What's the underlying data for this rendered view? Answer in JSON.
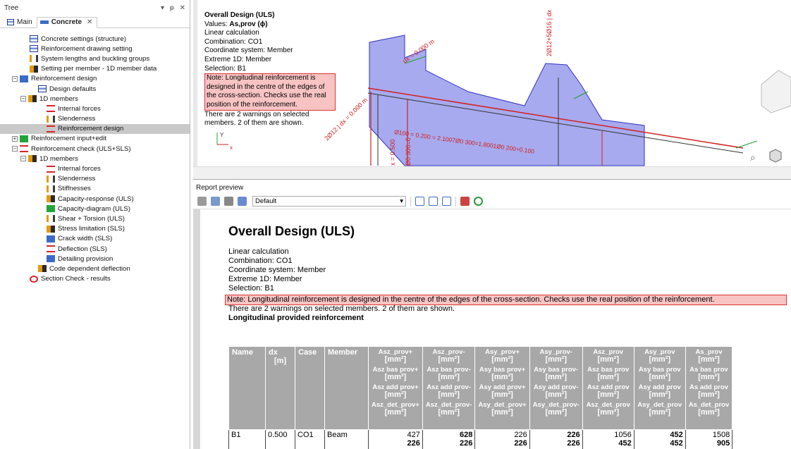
{
  "tree": {
    "title": "Tree",
    "controls": [
      "▾",
      "ᵽ",
      "✕"
    ],
    "tabs": [
      {
        "label": "Main",
        "active": false
      },
      {
        "label": "Concrete",
        "active": true
      }
    ],
    "items": [
      {
        "label": "Concrete settings (structure)",
        "indent": 1,
        "icon": "doc",
        "exp": ""
      },
      {
        "label": "Reinforcement drawing setting",
        "indent": 1,
        "icon": "doc",
        "exp": ""
      },
      {
        "label": "System lengths and buckling groups",
        "indent": 1,
        "icon": "bars",
        "exp": ""
      },
      {
        "label": "Setting per member - 1D member data",
        "indent": 1,
        "icon": "ora",
        "exp": ""
      },
      {
        "label": "Reinforcement design",
        "indent": 0,
        "icon": "blu",
        "exp": "−"
      },
      {
        "label": "Design defaults",
        "indent": 2,
        "icon": "doc",
        "exp": ""
      },
      {
        "label": "1D members",
        "indent": 1,
        "icon": "ora",
        "exp": "−"
      },
      {
        "label": "Internal forces",
        "indent": 3,
        "icon": "red",
        "exp": ""
      },
      {
        "label": "Slenderness",
        "indent": 3,
        "icon": "bars",
        "exp": ""
      },
      {
        "label": "Reinforcement design",
        "indent": 3,
        "icon": "red",
        "exp": "",
        "selected": true
      },
      {
        "label": "Reinforcement input+edit",
        "indent": 0,
        "icon": "grn",
        "exp": "+"
      },
      {
        "label": "Reinforcement check (ULS+SLS)",
        "indent": 0,
        "icon": "red",
        "exp": "−"
      },
      {
        "label": "1D members",
        "indent": 1,
        "icon": "ora",
        "exp": "−"
      },
      {
        "label": "Internal forces",
        "indent": 3,
        "icon": "red",
        "exp": ""
      },
      {
        "label": "Slenderness",
        "indent": 3,
        "icon": "bars",
        "exp": ""
      },
      {
        "label": "Stiffnesses",
        "indent": 3,
        "icon": "bars",
        "exp": ""
      },
      {
        "label": "Capacity-response (ULS)",
        "indent": 3,
        "icon": "ora",
        "exp": ""
      },
      {
        "label": "Capacity-diagram (ULS)",
        "indent": 3,
        "icon": "grn",
        "exp": ""
      },
      {
        "label": "Shear + Torsion (ULS)",
        "indent": 3,
        "icon": "bars",
        "exp": ""
      },
      {
        "label": "Stress limitation (SLS)",
        "indent": 3,
        "icon": "ora",
        "exp": ""
      },
      {
        "label": "Crack width (SLS)",
        "indent": 3,
        "icon": "blu",
        "exp": ""
      },
      {
        "label": "Deflection (SLS)",
        "indent": 3,
        "icon": "red",
        "exp": ""
      },
      {
        "label": "Detailing provision",
        "indent": 3,
        "icon": "blu",
        "exp": ""
      },
      {
        "label": "Code dependent deflection",
        "indent": 2,
        "icon": "ora",
        "exp": ""
      },
      {
        "label": "Section Check - results",
        "indent": 1,
        "icon": "tgt",
        "exp": ""
      }
    ]
  },
  "view": {
    "title": "Overall Design (ULS)",
    "values_prefix": "Values: ",
    "values_value": "As,prov (ϕ)",
    "calc": "Linear calculation",
    "combination": "Combination: CO1",
    "coord": "Coordinate system: Member",
    "extreme": "Extreme 1D: Member",
    "selection": "Selection: B1",
    "note": "Note: Longitudinal reinforcement is designed in the centre of the edges of the cross-section. Checks use the real position of the reinforcement.",
    "warnings": "There are 2 warnings on selected members. 2 of them are shown.",
    "labels": [
      "2Ø12+5Ø16 | dx",
      "dx = 0.000 m",
      "2Ø12 | dx = 0.000 m",
      "Ø100 = 0.200 = 2.1007Ø0 300=1.8001Ø0 200+0.100",
      "x = 0.500",
      "Ø0 300=0"
    ],
    "axis_y": "Y",
    "axis_x": "x",
    "colors": {
      "beam": "#8a8de8",
      "beam_edge": "#3333c0",
      "red_line": "#d22020",
      "green": "#22a032"
    }
  },
  "report": {
    "header": "Report preview",
    "template": "Default",
    "title": "Overall Design (ULS)",
    "calc": "Linear  calculation",
    "combination": "Combination:  CO1",
    "coord": "Coordinate  system: Member",
    "extreme": "Extreme 1D: Member",
    "selection": "Selection:  B1",
    "note": "Note: Longitudinal  reinforcement  is designed  in the centre of the edges of the cross-section.  Checks use the real position  of the reinforcement.",
    "warnings": "There are 2 warnings  on selected  members. 2 of them are shown.",
    "subtitle": "Longitudinal  provided  reinforcement",
    "table": {
      "headers": [
        {
          "name": "Name"
        },
        {
          "name": "dx",
          "unit": "[m]"
        },
        {
          "name": "Case"
        },
        {
          "name": "Member"
        },
        {
          "rows": [
            "Asz_prov+",
            "Asz bas prov+",
            "Asz add prov+",
            "Asz_det_prov+"
          ],
          "unit": "[mm²]"
        },
        {
          "rows": [
            "Asz_prov-",
            "Asz bas prov-",
            "Asz add prov-",
            "Asz_det_prov-"
          ],
          "unit": "[mm²]"
        },
        {
          "rows": [
            "Asy_prov+",
            "Asy bas prov+",
            "Asy add prov+",
            "Asy_det_prov+"
          ],
          "unit": "[mm²]"
        },
        {
          "rows": [
            "Asy_prov-",
            "Asy bas prov-",
            "Asy add prov-",
            "Asy_det_prov-"
          ],
          "unit": "[mm²]"
        },
        {
          "rows": [
            "Asz_prov",
            "Asz bas prov",
            "Asz add prov",
            "Asz_det_prov"
          ],
          "unit": "[mm²]"
        },
        {
          "rows": [
            "Asy_prov",
            "Asy bas prov",
            "Asy add prov",
            "Asy_det_prov"
          ],
          "unit": "[mm²]"
        },
        {
          "rows": [
            "As_prov",
            "As bas prov",
            "As add prov",
            "As_det_prov"
          ],
          "unit": "[mm²]"
        }
      ],
      "rows": [
        {
          "name": "B1",
          "dx": "0.500",
          "case": "CO1",
          "member": "Beam",
          "values": [
            [
              "427",
              "226"
            ],
            [
              "628",
              "226"
            ],
            [
              "226",
              "226"
            ],
            [
              "226",
              "226"
            ],
            [
              "1056",
              "452"
            ],
            [
              "452",
              "452"
            ],
            [
              "1508",
              "905"
            ]
          ]
        }
      ]
    }
  }
}
